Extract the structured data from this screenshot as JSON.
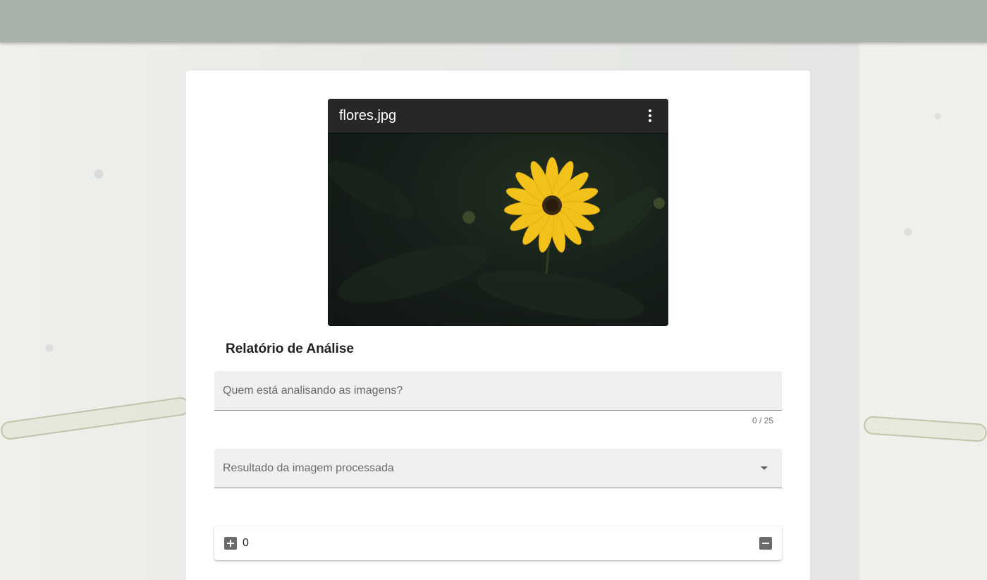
{
  "image_card": {
    "filename": "flores.jpg",
    "menu_icon": "more-vert-icon"
  },
  "report": {
    "title": "Relatório de Análise",
    "analyst_field": {
      "placeholder": "Quem está analisando as imagens?",
      "value": "",
      "counter": "0 / 25"
    },
    "result_select": {
      "label": "Resultado da imagem processada",
      "icon": "dropdown-caret-icon"
    },
    "quantity": {
      "value": "0",
      "increment_icon": "plus-box-icon",
      "decrement_icon": "minus-box-icon"
    }
  },
  "colors": {
    "top_bar": "#a8b2a9",
    "flower": "#f5c518",
    "field_bg": "#efefef"
  }
}
